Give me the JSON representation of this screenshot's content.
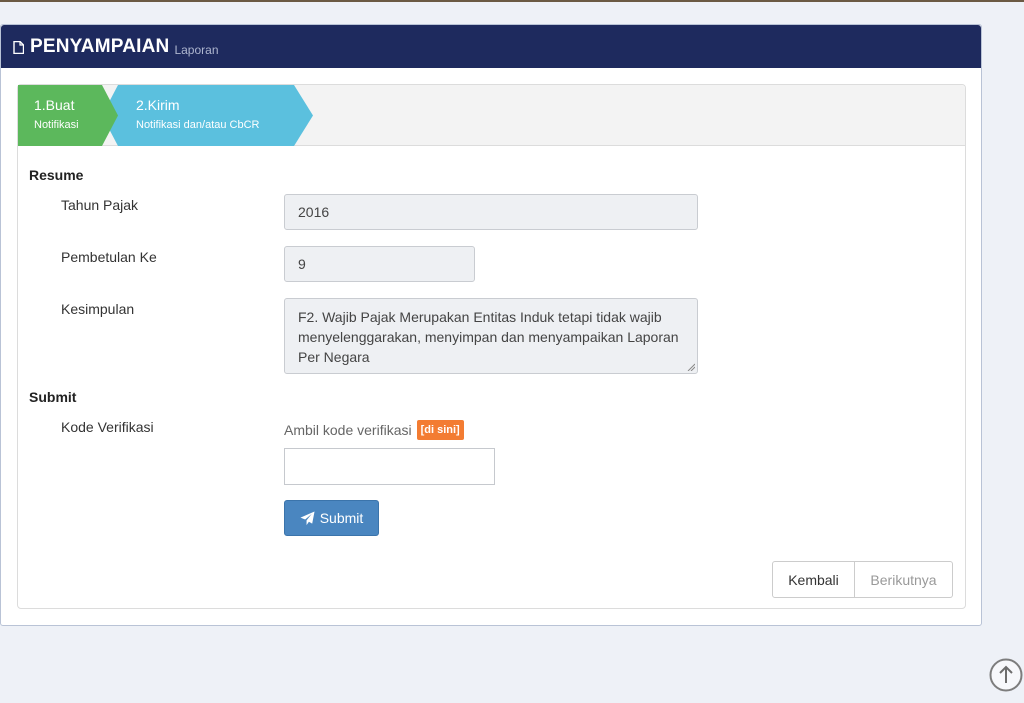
{
  "header": {
    "title": "PENYAMPAIAN",
    "subtitle": "Laporan",
    "icon": "document-icon"
  },
  "steps": [
    {
      "number": "1.Buat",
      "description": "Notifikasi",
      "color": "#5cb85c"
    },
    {
      "number": "2.Kirim",
      "description": "Notifikasi dan/atau CbCR",
      "color": "#5bc0de"
    }
  ],
  "resume": {
    "title": "Resume",
    "tahun_pajak": {
      "label": "Tahun Pajak",
      "value": "2016"
    },
    "pembetulan": {
      "label": "Pembetulan Ke",
      "value": "9"
    },
    "kesimpulan": {
      "label": "Kesimpulan",
      "value": "F2. Wajib Pajak Merupakan Entitas Induk tetapi tidak wajib menyelenggarakan, menyimpan dan menyampaikan Laporan Per Negara"
    }
  },
  "submit": {
    "title": "Submit",
    "kode_label": "Kode Verifikasi",
    "hint": "Ambil kode verifikasi",
    "hint_link": "[di sini]",
    "kode_value": "",
    "button_label": "Submit",
    "button_icon": "paper-plane-icon"
  },
  "nav": {
    "back": "Kembali",
    "next": "Berikutnya"
  },
  "colors": {
    "header": "#1e2a5e",
    "step_done": "#5cb85c",
    "step_active": "#5bc0de",
    "submit": "#4a86c0",
    "badge": "#f37c32"
  }
}
